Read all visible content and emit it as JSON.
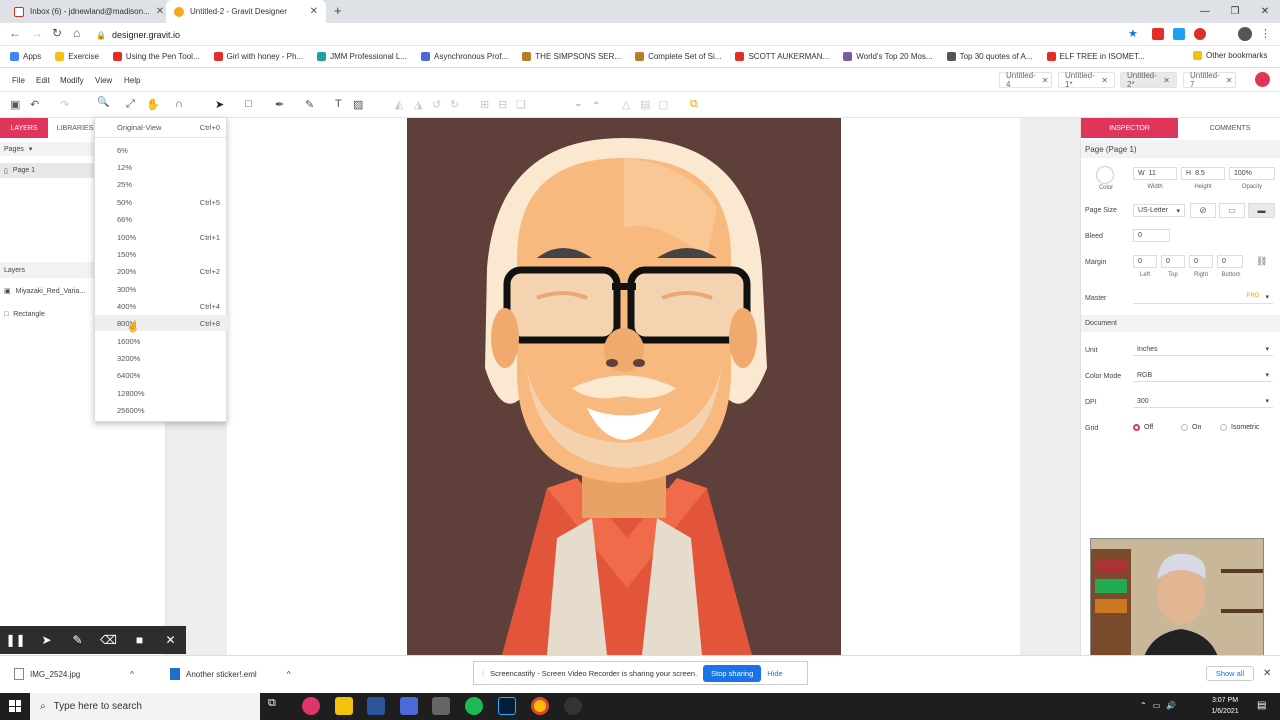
{
  "browser": {
    "tabs": [
      {
        "title": "Inbox (6) - jdnewland@madison..."
      },
      {
        "title": "Untitled-2 - Gravit Designer"
      }
    ],
    "url": "designer.gravit.io",
    "bookmarks": [
      {
        "label": "Apps",
        "color": "#4285f4"
      },
      {
        "label": "Exercise",
        "color": "#f4c20d"
      },
      {
        "label": "Using the Pen Tool...",
        "color": "#e52d27"
      },
      {
        "label": "Girl with honey - Ph...",
        "color": "#e52d27"
      },
      {
        "label": "JMM Professional L...",
        "color": "#1da1a1"
      },
      {
        "label": "Asynchronous Prof...",
        "color": "#4a6bd6"
      },
      {
        "label": "THE SIMPSONS SER...",
        "color": "#b97a2a"
      },
      {
        "label": "Complete Set of Si...",
        "color": "#b97a2a"
      },
      {
        "label": "SCOTT AUKERMAN...",
        "color": "#e52d27"
      },
      {
        "label": "World's Top 20 Mos...",
        "color": "#7a5aa3"
      },
      {
        "label": "Top 30 quotes of A...",
        "color": "#555"
      },
      {
        "label": "ELF TREE in ISOMET...",
        "color": "#e52d27"
      }
    ],
    "other_bookmarks": "Other bookmarks"
  },
  "app": {
    "menus": [
      "File",
      "Edit",
      "Modify",
      "View",
      "Help"
    ],
    "doc_tabs": [
      "Untitled-4",
      "Untitled-1*",
      "Untitled-2*",
      "Untitled-7"
    ],
    "active_doc_index": 2
  },
  "left_panel": {
    "tab_layers": "LAYERS",
    "tab_libraries": "LIBRARIES",
    "pages_header": "Pages",
    "pages": [
      "Page 1"
    ],
    "layers_header": "Layers",
    "layers": [
      "Miyazaki_Red_Varia...",
      "Rectangle"
    ]
  },
  "zoom_menu": {
    "items": [
      {
        "label": "Original-View",
        "shortcut": "Ctrl+0"
      },
      {
        "label": "6%",
        "shortcut": ""
      },
      {
        "label": "12%",
        "shortcut": ""
      },
      {
        "label": "25%",
        "shortcut": ""
      },
      {
        "label": "50%",
        "shortcut": "Ctrl+5"
      },
      {
        "label": "66%",
        "shortcut": ""
      },
      {
        "label": "100%",
        "shortcut": "Ctrl+1"
      },
      {
        "label": "150%",
        "shortcut": ""
      },
      {
        "label": "200%",
        "shortcut": "Ctrl+2"
      },
      {
        "label": "300%",
        "shortcut": ""
      },
      {
        "label": "400%",
        "shortcut": "Ctrl+4"
      },
      {
        "label": "800%",
        "shortcut": "Ctrl+8"
      },
      {
        "label": "1600%",
        "shortcut": ""
      },
      {
        "label": "3200%",
        "shortcut": ""
      },
      {
        "label": "6400%",
        "shortcut": ""
      },
      {
        "label": "12800%",
        "shortcut": ""
      },
      {
        "label": "25600%",
        "shortcut": ""
      }
    ],
    "hovered_index": 11,
    "current_zoom": "150%"
  },
  "inspector": {
    "tab_inspector": "INSPECTOR",
    "tab_comments": "COMMENTS",
    "title": "Page (Page 1)",
    "color_label": "Color",
    "width_prefix": "W",
    "width": "11",
    "width_label": "Width",
    "height_prefix": "H",
    "height": "8.5",
    "height_label": "Height",
    "opacity": "100%",
    "opacity_label": "Opacity",
    "page_size_label": "Page Size",
    "page_size": "US-Letter",
    "bleed_label": "Bleed",
    "bleed": "0",
    "margin_label": "Margin",
    "margins": [
      {
        "v": "0",
        "l": "Left"
      },
      {
        "v": "0",
        "l": "Top"
      },
      {
        "v": "0",
        "l": "Right"
      },
      {
        "v": "0",
        "l": "Bottom"
      }
    ],
    "master_label": "Master",
    "master_badge": "PRO",
    "document_section": "Document",
    "unit_label": "Unit",
    "unit": "Inches",
    "color_mode_label": "Color Mode",
    "color_mode": "RGB",
    "dpi_label": "DPI",
    "dpi": "300",
    "grid_label": "Grid",
    "grid_options": [
      "Off",
      "On",
      "Isometric"
    ],
    "grid_selected": "Off"
  },
  "recorder": {
    "share_text": "Screencastify - Screen Video Recorder is sharing your screen.",
    "stop": "Stop sharing",
    "hide": "Hide"
  },
  "downloads": {
    "items": [
      "IMG_2524.jpg",
      "Another sticker!.eml"
    ],
    "show_all": "Show all"
  },
  "taskbar": {
    "search_placeholder": "Type here to search",
    "time": "3:07 PM",
    "date": "1/6/2021"
  },
  "colors": {
    "accent": "#e0355b",
    "art_bg": "#5e3f3a",
    "skin": "#f7b97d",
    "hair": "#fbe8d0",
    "shirt": "#e2553b"
  }
}
